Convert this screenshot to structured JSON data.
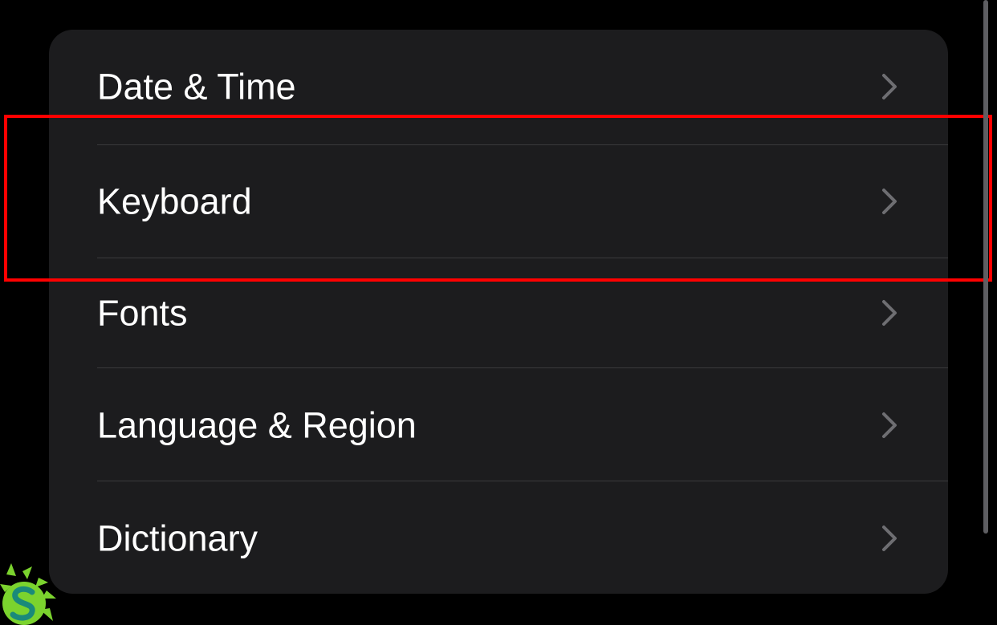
{
  "settings_list": {
    "items": [
      {
        "label": "Date & Time",
        "chevron_icon": "chevron-right-icon"
      },
      {
        "label": "Keyboard",
        "chevron_icon": "chevron-right-icon"
      },
      {
        "label": "Fonts",
        "chevron_icon": "chevron-right-icon"
      },
      {
        "label": "Language & Region",
        "chevron_icon": "chevron-right-icon"
      },
      {
        "label": "Dictionary",
        "chevron_icon": "chevron-right-icon"
      }
    ],
    "highlighted_item": "Keyboard"
  },
  "colors": {
    "background": "#000000",
    "card": "#1c1c1e",
    "separator": "#3a3a3c",
    "text": "#ffffff",
    "chevron": "#6e6e72",
    "highlight": "#ff0000",
    "scrollbar": "#5e5e62",
    "logo_green": "#7bd32e",
    "logo_teal": "#1a8a7a"
  },
  "icons": {
    "chevron": "chevron-right-icon",
    "logo": "sun-logo-icon",
    "scrollbar": "scrollbar-thumb"
  }
}
